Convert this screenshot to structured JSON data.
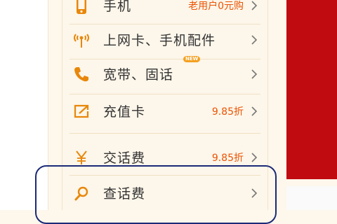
{
  "colors": {
    "accent": "#ea5404",
    "icon": "#e8870a",
    "text": "#333333",
    "panel_bg": "#fdf6ea",
    "banner_red": "#c00b10",
    "annotation": "#1c2a78"
  },
  "menu": {
    "items": [
      {
        "label": "手机",
        "promo": "老用户0元购",
        "icon": "phone-icon"
      },
      {
        "label": "上网卡、手机配件",
        "promo": "",
        "icon": "antenna-icon"
      },
      {
        "label": "宽带、固话",
        "promo": "",
        "icon": "handset-icon",
        "badge": "NEW"
      },
      {
        "label": "充值卡",
        "promo": "9.85折",
        "icon": "recharge-card-icon"
      },
      {
        "label": "交话费",
        "promo": "9.85折",
        "icon": "yen-icon"
      },
      {
        "label": "查话费",
        "promo": "",
        "icon": "search-icon"
      }
    ]
  }
}
